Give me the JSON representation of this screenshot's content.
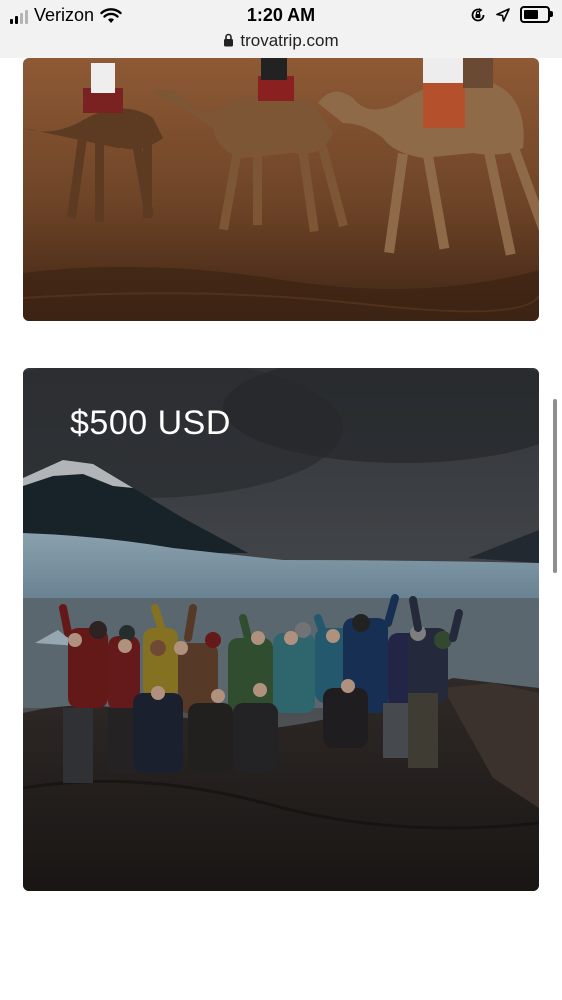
{
  "status_bar": {
    "carrier": "Verizon",
    "time": "1:20 AM",
    "url": "trovatrip.com",
    "battery_level": 0.65
  },
  "cards": [
    {
      "image_alt": "Camel caravan in the desert",
      "price": ""
    },
    {
      "image_alt": "Group of travelers in front of a glacier",
      "price": "$500 USD"
    }
  ],
  "icons": {
    "signal": "signal-icon",
    "wifi": "wifi-icon",
    "lock": "lock-icon",
    "rotation_lock": "rotation-lock-icon",
    "location": "location-arrow-icon",
    "battery": "battery-icon"
  }
}
